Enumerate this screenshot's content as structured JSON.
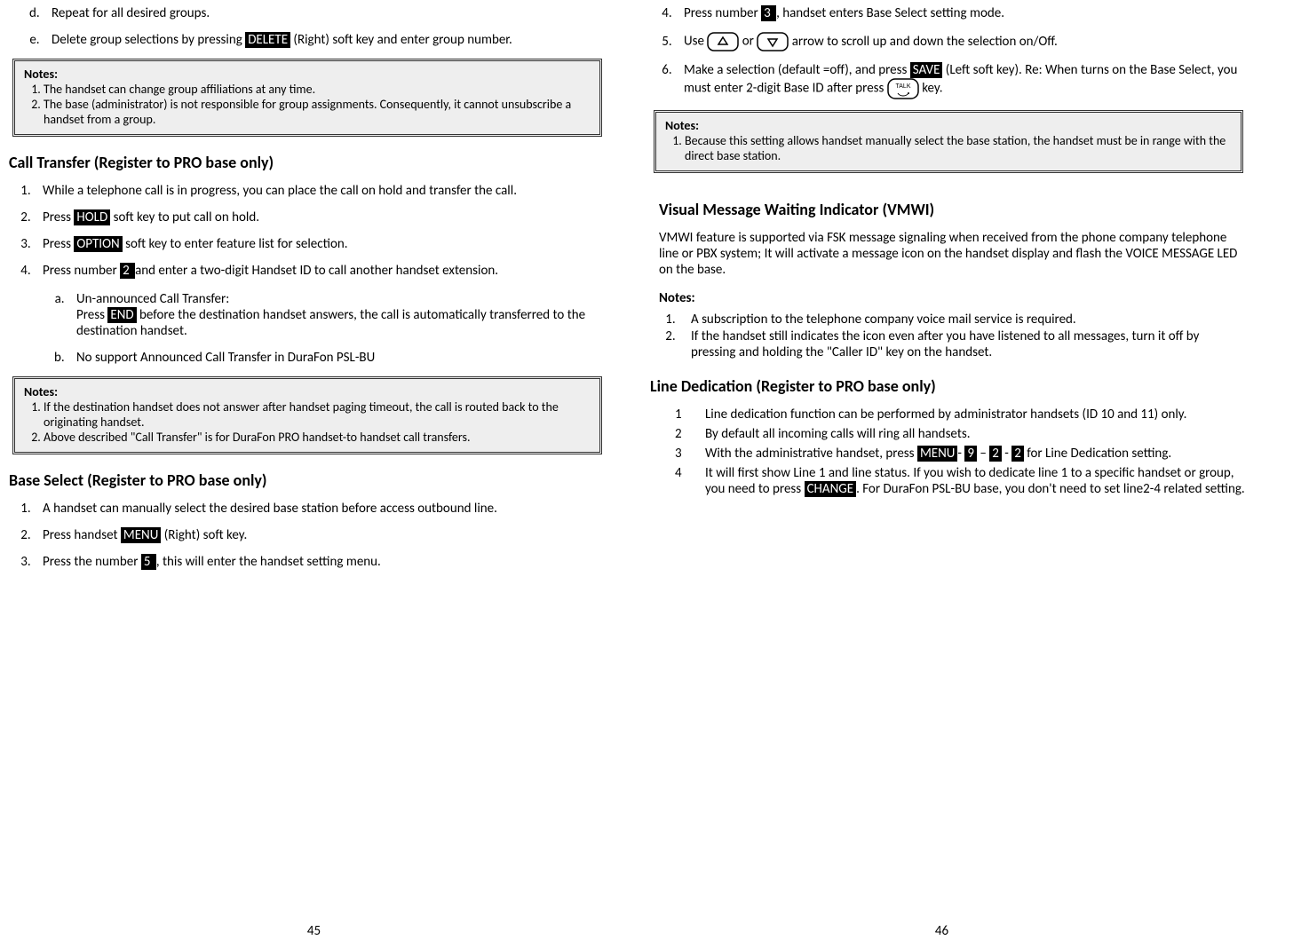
{
  "left": {
    "item_d": "Repeat for all desired groups.",
    "item_e_a": "Delete group selections by pressing ",
    "item_e_key": "DELETE",
    "item_e_b": " (Right) soft key and enter group number.",
    "notes1": {
      "title": "Notes:",
      "n1": "The handset can change group affiliations at any time.",
      "n2": "The base (administrator) is not responsible for group assignments. Consequently, it cannot unsubscribe a handset from a group."
    },
    "h_call_transfer": "Call Transfer (Register to PRO base only)",
    "ct1": "While a telephone call is in progress, you can place the call on hold and transfer the call.",
    "ct2_a": "Press ",
    "ct2_key": "HOLD",
    "ct2_b": " soft key to put call on hold.",
    "ct3_a": "Press ",
    "ct3_key": "OPTION",
    "ct3_b": " soft key to enter feature list for selection.",
    "ct4_a": "Press number ",
    "ct4_key": " 2 ",
    "ct4_b": " and enter a two-digit Handset ID to call another handset extension.",
    "ct4a_a": "Un-announced Call Transfer:",
    "ct4a_b1": "Press ",
    "ct4a_key": "END",
    "ct4a_b2": " before the destination handset answers, the call is automatically transferred to the destination handset.",
    "ct4b": "No support Announced Call Transfer in DuraFon PSL-BU",
    "notes2": {
      "title": "Notes:",
      "n1": "If the destination handset does not answer after handset paging timeout, the call is routed back to the originating handset.",
      "n2": "Above described \"Call Transfer\" is for DuraFon PRO handset-to handset call transfers."
    },
    "h_base_select": "Base Select (Register to PRO base only)",
    "bs1": "A handset can manually select the desired base station before access outbound line.",
    "bs2_a": "Press handset ",
    "bs2_key": "MENU",
    "bs2_b": " (Right) soft key.",
    "bs3_a": "Press the number ",
    "bs3_key": " 5 ",
    "bs3_b": ", this will enter the handset setting menu.",
    "page_num": "45"
  },
  "right": {
    "bs4_a": "Press number ",
    "bs4_key": " 3 ",
    "bs4_b": ", handset enters Base Select setting mode.",
    "bs5_a": "Use ",
    "bs5_b": " or ",
    "bs5_c": " arrow to scroll up and down the selection on/Off.",
    "bs6_a": "Make a selection (default =off), and press ",
    "bs6_key": "SAVE",
    "bs6_b": " (Left soft key). Re: When turns on the Base Select, you must enter 2-digit Base ID after press ",
    "bs6_c": " key.",
    "notes3": {
      "title": "Notes:",
      "n1": "Because this setting allows handset manually select the base station, the handset must be in range with the direct base station."
    },
    "h_vmwi": "Visual Message Waiting Indicator (VMWI)",
    "vmwi_p": "VMWI feature is supported via FSK message signaling when received from the phone company telephone line or PBX system; It will activate a message icon on the handset display and flash the VOICE MESSAGE LED on the base.",
    "vmwi_notes_title": "Notes:",
    "vmwi_n1": "A subscription to the telephone company voice mail service is required.",
    "vmwi_n2": "If the handset still indicates the icon even after you have listened to all messages, turn it off by pressing and holding the \"Caller ID\" key on the handset.",
    "h_line_ded": "Line Dedication (Register to PRO base only)",
    "ld1_n": "1",
    "ld1": "Line dedication function can be performed by administrator handsets (ID 10 and 11) only.",
    "ld2_n": "2",
    "ld2": "By default all incoming calls will ring all handsets.",
    "ld3_n": "3",
    "ld3_a": "With the administrative handset, press ",
    "ld3_k1": "MENU",
    "ld3_s1": "- ",
    "ld3_k2": "9",
    "ld3_s2": " – ",
    "ld3_k3": "2",
    "ld3_s3": " - ",
    "ld3_k4": "2",
    "ld3_b": " for Line Dedication setting.",
    "ld4_n": "4",
    "ld4_a": "It will first show Line 1 and line status. If you wish to dedicate line 1 to a specific handset or group, you need to press ",
    "ld4_key": "CHANGE",
    "ld4_b": ". For DuraFon PSL-BU base, you don't need to set line2-4 related setting.",
    "page_num": "46"
  }
}
